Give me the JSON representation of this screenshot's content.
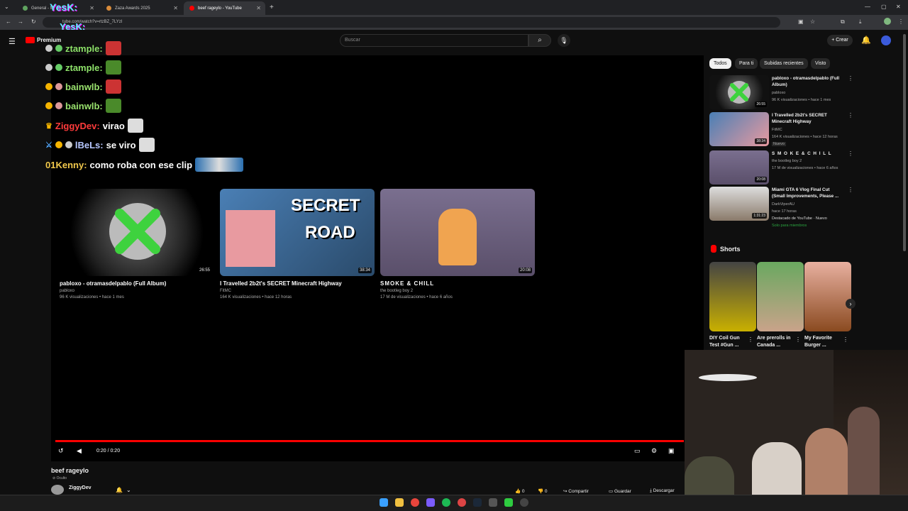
{
  "browser": {
    "tabs": [
      {
        "label": "General - Mi",
        "active": false
      },
      {
        "label": "Zaza Awards 2025",
        "active": false
      },
      {
        "label": "beef rageylo - YouTube",
        "active": true
      }
    ],
    "url": "tube.com/watch?v=rtzBZ_7LYzI",
    "overlay_text": "YesK:"
  },
  "youtube": {
    "logo_label": "Premium",
    "search_placeholder": "Buscar",
    "create_label": "+ Crear",
    "chips": [
      "Todos",
      "Para ti",
      "Subidas recientes",
      "Visto"
    ]
  },
  "chat": [
    {
      "user": "ztample:",
      "color": "#8ee26a",
      "message": ""
    },
    {
      "user": "ztample:",
      "color": "#8ee26a",
      "message": ""
    },
    {
      "user": "bainwlb:",
      "color": "#9ae36e",
      "message": ""
    },
    {
      "user": "bainwlb:",
      "color": "#9ae36e",
      "message": ""
    },
    {
      "user": "ZiggyDev:",
      "color": "#ff3b3b",
      "message": "virao"
    },
    {
      "user": "lBeLs:",
      "color": "#b7c7ff",
      "message": "se viro"
    },
    {
      "user": "01Kenny:",
      "color": "#f2c94c",
      "message": "como roba con ese clip"
    }
  ],
  "endscreen": [
    {
      "title": "pabloxo - otramasdelpablo (Full Album)",
      "channel": "pabloxo",
      "meta": "96 K visualizaciones • hace 1 mes",
      "duration": "26:55"
    },
    {
      "title": "I Travelled 2b2t's SECRET Minecraft Highway",
      "channel": "FitMC",
      "meta": "164 K visualizaciones • hace 12 horas",
      "duration": "38:34",
      "thumb_text": [
        "SECRET",
        "ROAD"
      ]
    },
    {
      "title": "SMOKE & CHILL",
      "channel": "the bootleg boy 2",
      "meta": "17 M de visualizaciones • hace 6 años",
      "duration": "20:08"
    }
  ],
  "player": {
    "time": "0:20 / 0:20",
    "video_title": "beef rageylo",
    "visibility": "Oculto",
    "channel": "ZiggyDev"
  },
  "actions": {
    "likes": "0",
    "dislikes": "0",
    "share": "Compartir",
    "save": "Guardar",
    "download": "Descargar"
  },
  "recommendations": [
    {
      "title": "pabloxo - otramasdelpablo (Full Album)",
      "channel": "pabloxo",
      "meta": "96 K visualizaciones • hace 1 mes",
      "duration": "26:55",
      "badge": ""
    },
    {
      "title": "I Travelled 2b2t's SECRET Minecraft Highway",
      "channel": "FitMC",
      "meta": "164 K visualizaciones • hace 12 horas",
      "duration": "38:34",
      "badge": "Nuevo"
    },
    {
      "title": "S M O K E & C H I L L",
      "channel": "the bootleg boy 2",
      "meta": "17 M de visualizaciones • hace 6 años",
      "duration": "20:08",
      "badge": ""
    },
    {
      "title": "Miami GTA 6 Vlog Final Cut (Small Improvements, Please ...",
      "channel": "DarkViperAU",
      "meta": "hace 17 horas",
      "duration": "1:31:23",
      "badge": "Destacado de YouTube · Nuevo",
      "extra": "Solo para miembros"
    }
  ],
  "shorts": {
    "heading": "Shorts",
    "items": [
      {
        "title": "DIY Coil Gun Test #Gun ..."
      },
      {
        "title": "Are prerolls in Canada ..."
      },
      {
        "title": "My Favorite Burger ..."
      }
    ]
  }
}
